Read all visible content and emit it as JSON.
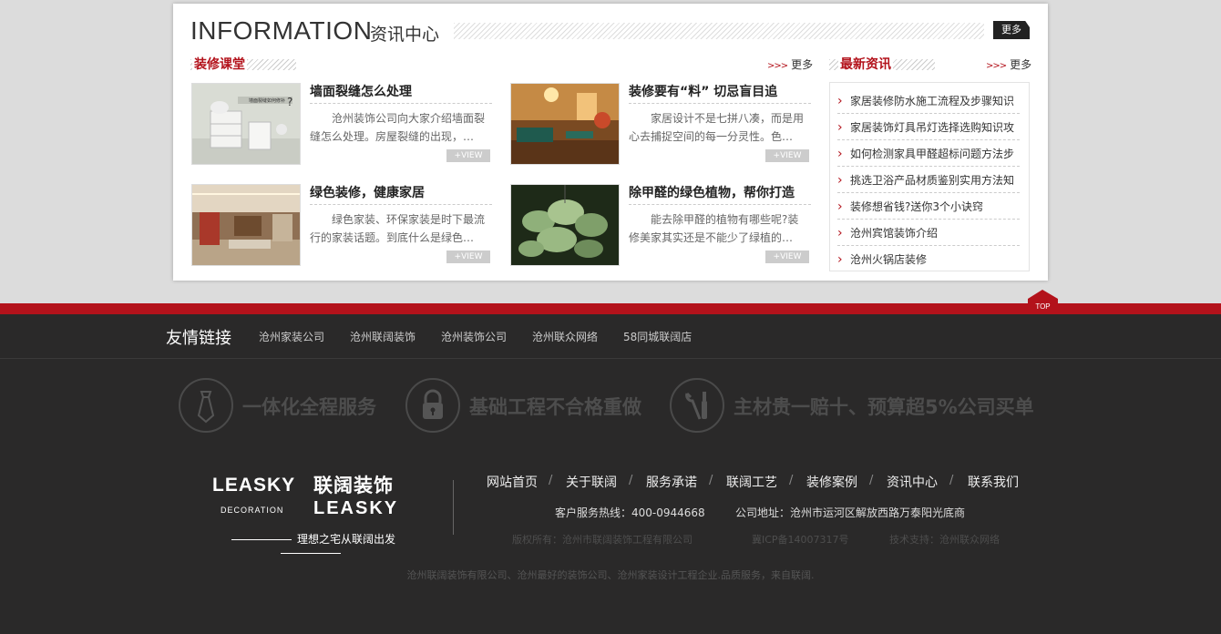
{
  "info": {
    "title": "INFORMATION",
    "subtitle": "资讯中心",
    "more": "更多"
  },
  "course": {
    "title": "装修课堂",
    "more": "更多",
    "articles": [
      {
        "title": "墙面裂缝怎么处理",
        "desc": "沧州装饰公司向大家介绍墙面裂缝怎么处理。房屋裂缝的出现，…",
        "view": "+VIEW"
      },
      {
        "title": "装修要有“料” 切忌盲目追",
        "desc": "家居设计不是七拼八凑，而是用心去捕捉空间的每一分灵性。色…",
        "view": "+VIEW"
      },
      {
        "title": "绿色装修，健康家居",
        "desc": "绿色家装、环保家装是时下最流行的家装话题。到底什么是绿色…",
        "view": "+VIEW"
      },
      {
        "title": "除甲醛的绿色植物，帮你打造",
        "desc": "能去除甲醛的植物有哪些呢?装修美家其实还是不能少了绿植的…",
        "view": "+VIEW"
      }
    ],
    "thumb1_caption": "墙面裂缝如何修补"
  },
  "latest": {
    "title": "最新资讯",
    "more": "更多",
    "items": [
      "家居装修防水施工流程及步骤知识",
      "家居装饰灯具吊灯选择选购知识攻",
      "如何检测家具甲醛超标问题方法步",
      "挑选卫浴产品材质鉴别实用方法知",
      "装修想省钱?送你3个小诀窍",
      "沧州宾馆装饰介绍",
      "沧州火锅店装修"
    ]
  },
  "top_label": "TOP",
  "friend_links": {
    "title": "友情链接",
    "links": [
      "沧州家装公司",
      "沧州联阔装饰",
      "沧州装饰公司",
      "沧州联众网络",
      "58同城联阔店"
    ]
  },
  "promises": [
    "一体化全程服务",
    "基础工程不合格重做",
    "主材贵一赔十、预算超5%公司买单"
  ],
  "logo": {
    "en": "LEASKY",
    "cn": "联阔装饰",
    "decoration": "DECORATION",
    "en2": "LEASKY",
    "slogan": "理想之宅从联阔出发"
  },
  "nav": [
    "网站首页",
    "关于联阔",
    "服务承诺",
    "联阔工艺",
    "装修案例",
    "资讯中心",
    "联系我们"
  ],
  "nav_sep": "/",
  "contact": {
    "hotline": "客户服务热线：400-0944668",
    "address": "公司地址：沧州市运河区解放西路万泰阳光底商"
  },
  "copyright": {
    "owner": "版权所有：沧州市联阔装饰工程有限公司",
    "icp": "冀ICP备14007317号",
    "support": "技术支持：沧州联众网络"
  },
  "bottom_text": "沧州联阔装饰有限公司、沧州最好的装饰公司、沧州家装设计工程企业.品质服务，来自联阔."
}
